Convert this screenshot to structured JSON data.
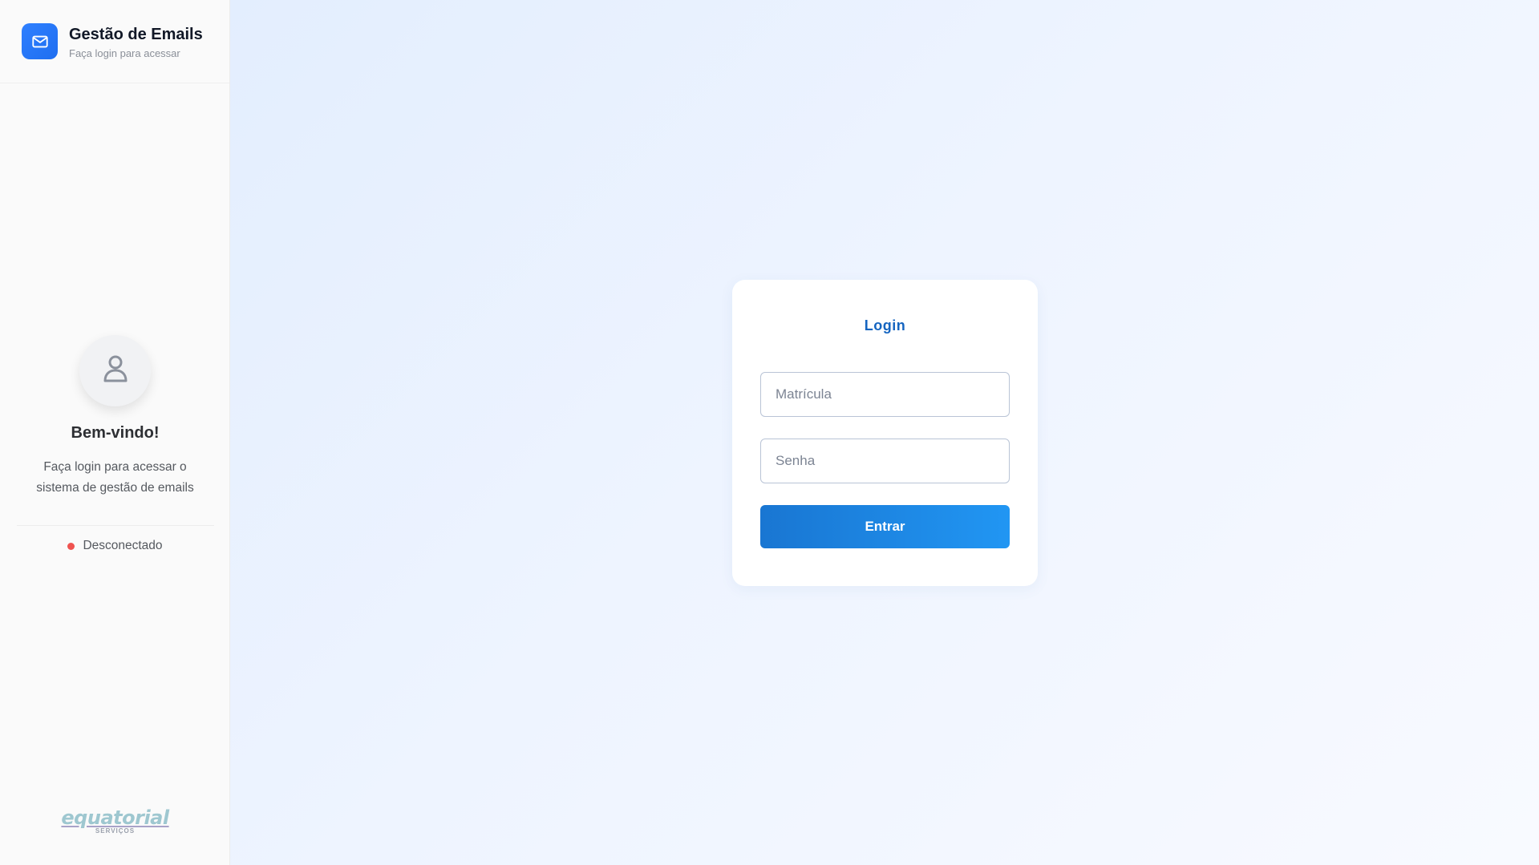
{
  "sidebar": {
    "header": {
      "icon": "mail-icon",
      "title": "Gestão de Emails",
      "subtitle": "Faça login para acessar"
    },
    "welcome": {
      "avatar_icon": "user-icon",
      "title": "Bem-vindo!",
      "text": "Faça login para acessar o sistema de gestão de emails"
    },
    "status": {
      "label": "Desconectado",
      "color": "#ef5350"
    },
    "logo": {
      "name": "equatorial",
      "sub": "SERVIÇOS"
    }
  },
  "login": {
    "title": "Login",
    "username_placeholder": "Matrícula",
    "username_value": "",
    "password_placeholder": "Senha",
    "password_value": "",
    "submit_label": "Entrar"
  },
  "colors": {
    "accent": "#1976d2",
    "brand": "#2f80ff",
    "title": "#1565c0"
  }
}
